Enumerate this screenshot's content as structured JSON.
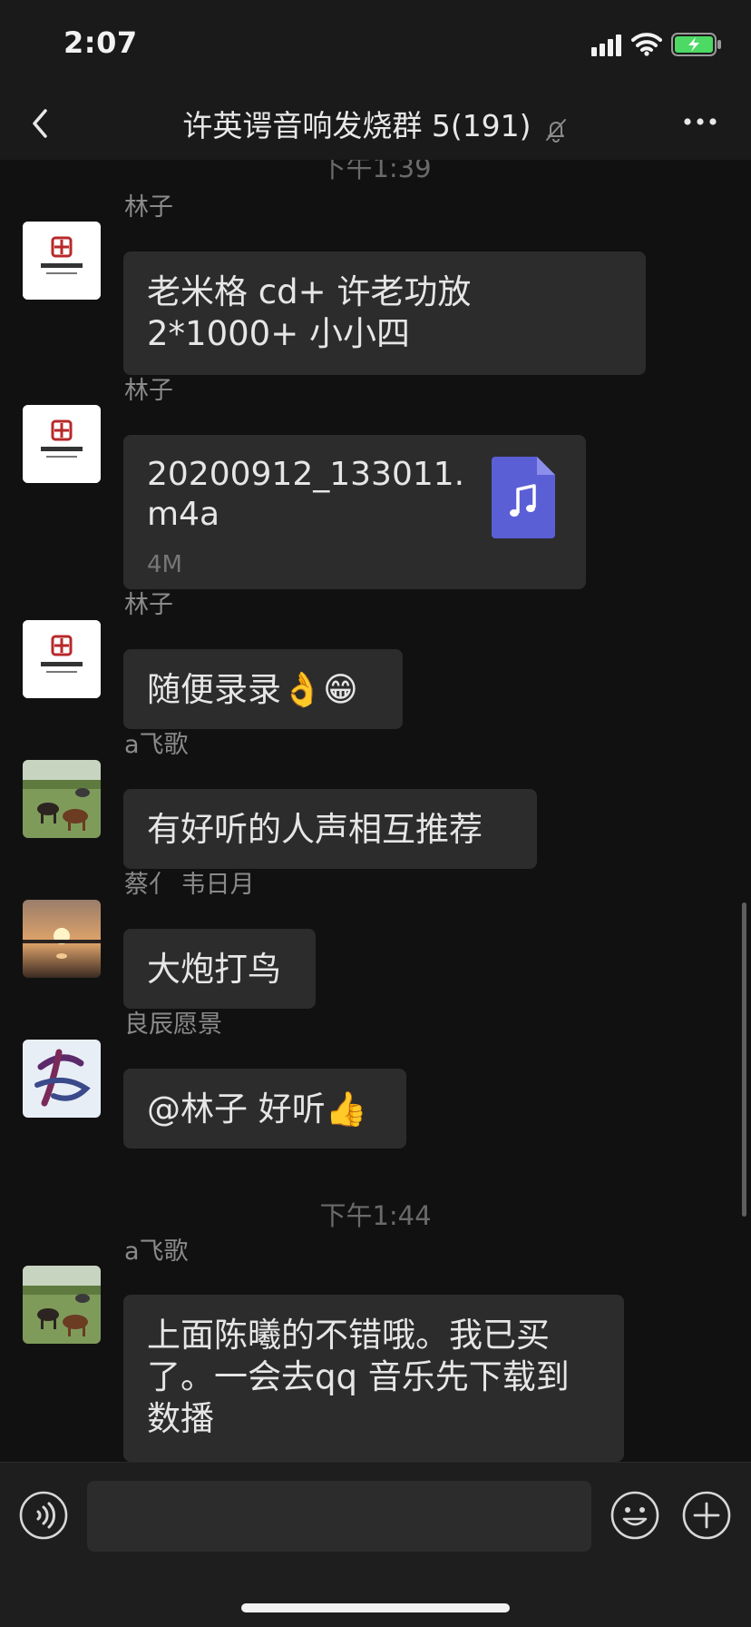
{
  "status_bar": {
    "time": "2:07"
  },
  "nav": {
    "title": "许英谔音响发烧群 5(191)"
  },
  "timestamps": {
    "first": "下午1:39",
    "second": "下午1:44"
  },
  "messages": [
    {
      "sender": "林子",
      "text": "老米格 cd+ 许老功放 2*1000+ 小小四",
      "avatar": "logo-avatar"
    },
    {
      "sender": "林子",
      "file_name": "20200912_133011.m4a",
      "file_size": "4M",
      "icon": "music-file-icon",
      "avatar": "logo-avatar"
    },
    {
      "sender": "林子",
      "text": "随便录录👌😁",
      "avatar": "logo-avatar"
    },
    {
      "sender": "a飞歌",
      "text": "有好听的人声相互推荐",
      "avatar": "horses-avatar"
    },
    {
      "sender": "蔡亻 韦日月",
      "text": "大炮打鸟",
      "avatar": "sunset-avatar"
    },
    {
      "sender": "良辰愿景",
      "text": "@林子 好听👍",
      "avatar": "calligraphy-avatar"
    },
    {
      "sender": "a飞歌",
      "text": "上面陈曦的不错哦。我已买了。一会去qq 音乐先下载到数播",
      "avatar": "horses-avatar"
    }
  ],
  "colors": {
    "background": "#111111",
    "bubble": "#2c2c2c",
    "file_icon": "#5b5fd6",
    "battery": "#4cd964"
  },
  "input": {
    "value": "",
    "placeholder": ""
  }
}
